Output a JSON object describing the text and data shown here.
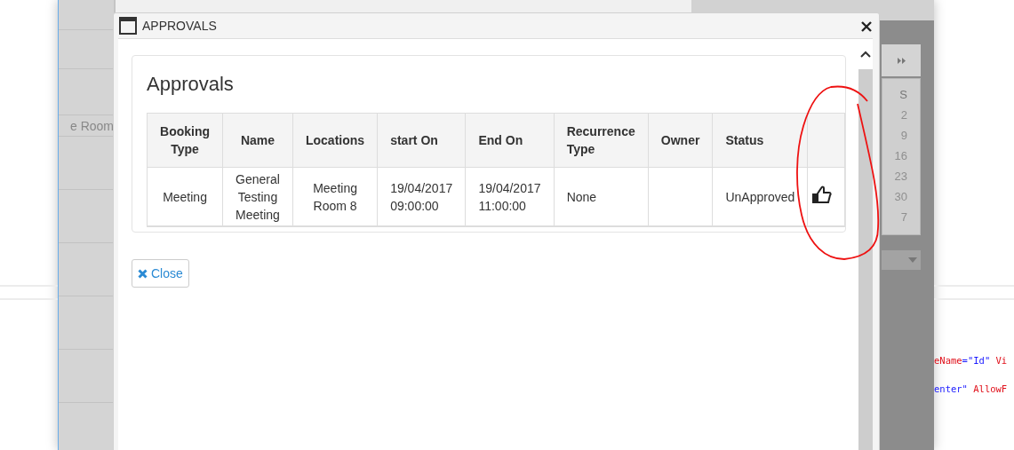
{
  "background": {
    "sidebar_items": [
      "e Room"
    ],
    "calendar": {
      "day_header": "S",
      "days": [
        "2",
        "9",
        "16",
        "23",
        "30",
        "7"
      ]
    },
    "code_lines": [
      [
        {
          "kind": "attr",
          "text": "eName"
        },
        {
          "kind": "value",
          "text": "=\"Id\""
        },
        {
          "kind": "attr",
          "text": " Vi"
        }
      ],
      [
        {
          "kind": "value",
          "text": "enter\""
        },
        {
          "kind": "attr",
          "text": " AllowF"
        }
      ]
    ]
  },
  "dialog": {
    "title": "APPROVALS",
    "panel_title": "Approvals",
    "table": {
      "columns": [
        "Booking Type",
        "Name",
        "Locations",
        "start On",
        "End On",
        "Recurrence Type",
        "Owner",
        "Status",
        ""
      ],
      "rows": [
        {
          "cells": [
            "Meeting",
            "General Testing Meeting",
            "Meeting Room 8",
            "19/04/2017 09:00:00",
            "19/04/2017 11:00:00",
            "None",
            "",
            "UnApproved"
          ]
        }
      ]
    },
    "close_button": "Close"
  }
}
